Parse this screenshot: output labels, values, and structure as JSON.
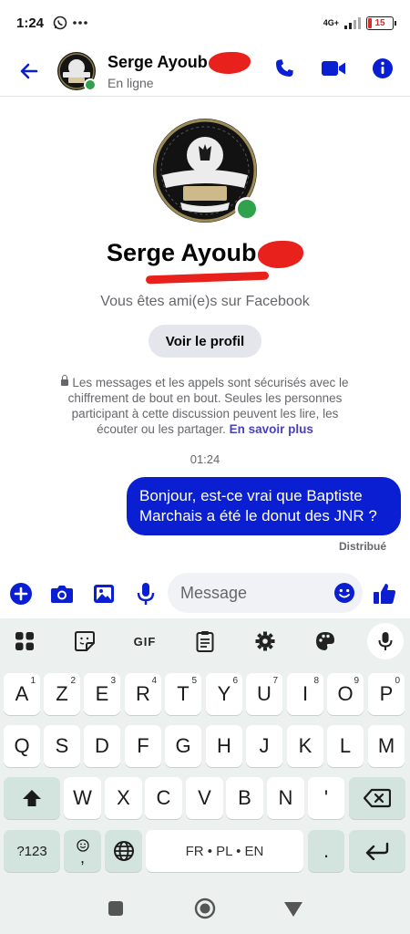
{
  "status_bar": {
    "time": "1:24",
    "network": "4G+",
    "battery": "15"
  },
  "header": {
    "contact_name": "Serge Ayoub",
    "status": "En ligne"
  },
  "profile": {
    "name": "Serge Ayoub",
    "friends_text": "Vous êtes ami(e)s sur Facebook",
    "view_profile_label": "Voir le profil"
  },
  "security": {
    "text": "Les messages et les appels sont sécurisés avec le chiffrement de bout en bout. Seules les personnes participant à cette discussion peuvent les lire, les écouter ou les partager. ",
    "link_label": "En savoir plus"
  },
  "conversation": {
    "timestamp": "01:24",
    "message": "Bonjour, est-ce vrai que Baptiste Marchais a été le donut des JNR ?",
    "delivery_status": "Distribué"
  },
  "composer": {
    "placeholder": "Message"
  },
  "keyboard": {
    "toolbar_gif": "GIF",
    "row1": [
      {
        "k": "A",
        "n": "1"
      },
      {
        "k": "Z",
        "n": "2"
      },
      {
        "k": "E",
        "n": "3"
      },
      {
        "k": "R",
        "n": "4"
      },
      {
        "k": "T",
        "n": "5"
      },
      {
        "k": "Y",
        "n": "6"
      },
      {
        "k": "U",
        "n": "7"
      },
      {
        "k": "I",
        "n": "8"
      },
      {
        "k": "O",
        "n": "9"
      },
      {
        "k": "P",
        "n": "0"
      }
    ],
    "row2": [
      "Q",
      "S",
      "D",
      "F",
      "G",
      "H",
      "J",
      "K",
      "L",
      "M"
    ],
    "row3": [
      "W",
      "X",
      "C",
      "V",
      "B",
      "N",
      "'"
    ],
    "symbols_label": "?123",
    "comma_label": ",",
    "space_label": "FR • PL • EN",
    "period_label": "."
  },
  "colors": {
    "brand_blue": "#0a1fd1",
    "online_green": "#31a24c",
    "redaction_red": "#e8211c",
    "keyboard_bg": "#ecf1ef"
  }
}
